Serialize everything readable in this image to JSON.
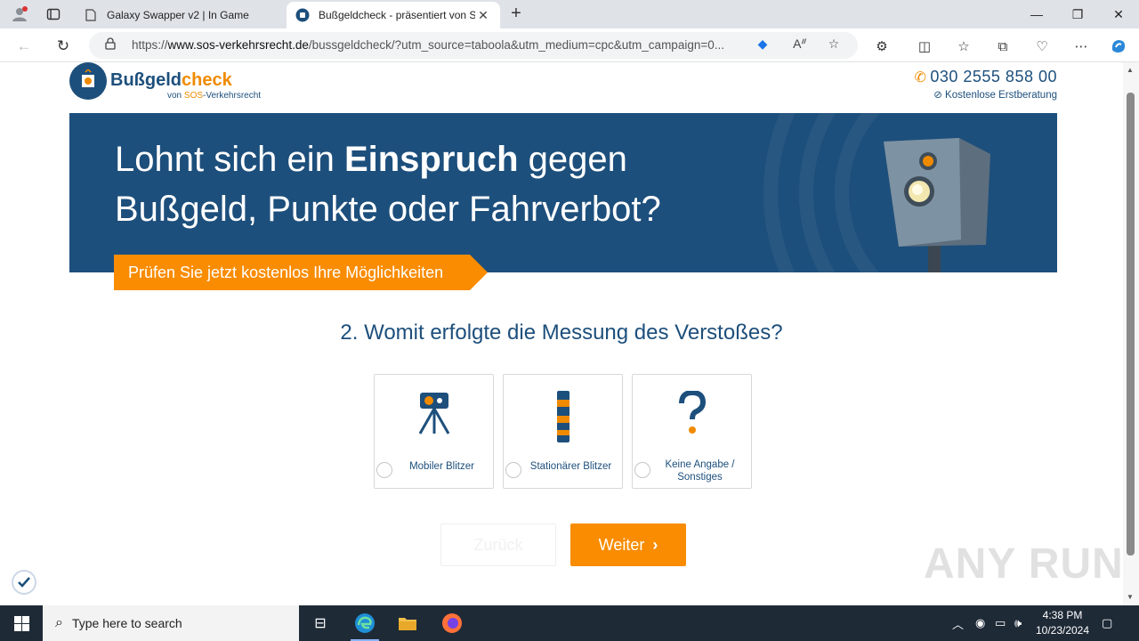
{
  "browser": {
    "tabs": [
      {
        "title": "Galaxy Swapper v2 | In Game",
        "active": false
      },
      {
        "title": "Bußgeldcheck - präsentiert von S",
        "active": true
      }
    ],
    "url_prefix": "https://",
    "url_domain": "www.sos-verkehrsrecht.de",
    "url_rest": "/bussgeldcheck/?utm_source=taboola&utm_medium=cpc&utm_campaign=0..."
  },
  "site": {
    "logo_name_a": "Bußgeld",
    "logo_name_b": "check",
    "logo_sub_a": "von ",
    "logo_sub_b": "SOS",
    "logo_sub_c": "-Verkehrsrecht",
    "phone": "030 2555 858 00",
    "phone_note": "Kostenlose Erstberatung"
  },
  "hero": {
    "line1_a": "Lohnt sich ein ",
    "line1_b": "Einspruch",
    "line1_c": " gegen",
    "line2": "Bußgeld, Punkte oder Fahrverbot?",
    "ribbon": "Prüfen Sie jetzt kostenlos Ihre Möglichkeiten"
  },
  "form": {
    "question": "2. Womit erfolgte die Messung des Verstoßes?",
    "options": [
      {
        "label": "Mobiler Blitzer",
        "icon": "tripod-camera-icon"
      },
      {
        "label": "Stationärer Blitzer",
        "icon": "speed-pillar-icon"
      },
      {
        "label": "Keine Angabe / Sonstiges",
        "icon": "question-mark-icon"
      }
    ],
    "back_label": "Zurück",
    "next_label": "Weiter"
  },
  "watermark": "ANY RUN",
  "taskbar": {
    "search_placeholder": "Type here to search",
    "time": "4:38 PM",
    "date": "10/23/2024"
  },
  "colors": {
    "brand_blue": "#1d4f7c",
    "brand_orange": "#f98c00"
  }
}
